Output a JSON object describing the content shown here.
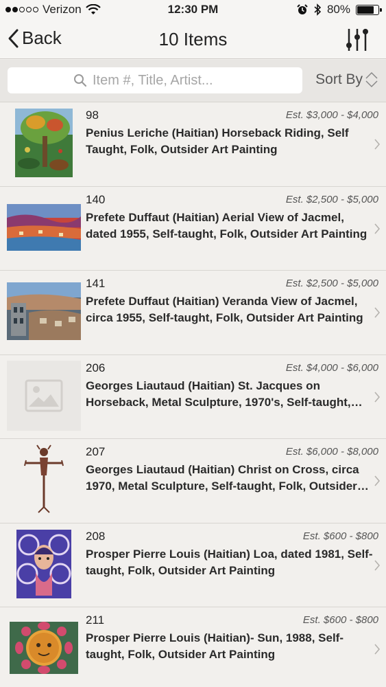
{
  "status_bar": {
    "carrier": "Verizon",
    "time": "12:30 PM",
    "battery": "80%",
    "battery_level": 0.8,
    "signal_bars_filled": 2,
    "signal_bars_total": 5
  },
  "nav": {
    "back_label": "Back",
    "title": "10 Items",
    "filter_icon": "sliders-icon"
  },
  "search": {
    "placeholder": "Item #, Title, Artist...",
    "sort_label": "Sort By"
  },
  "items": [
    {
      "lot": "98",
      "estimate": "Est. $3,000 - $4,000",
      "title": "Penius Leriche (Haitian)  Horseback Riding, Self Taught, Folk, Outsider Art Painting",
      "thumb": "painting-tree"
    },
    {
      "lot": "140",
      "estimate": "Est. $2,500 - $5,000",
      "title": "Prefete Duffaut (Haitian) Aerial View of Jacmel, dated 1955, Self-taught, Folk, Outsider Art Painting",
      "thumb": "painting-aerial"
    },
    {
      "lot": "141",
      "estimate": "Est. $2,500 - $5,000",
      "title": "Prefete Duffaut (Haitian) Veranda View of Jacmel, circa 1955, Self-taught, Folk, Outsider Art Painting",
      "thumb": "painting-veranda"
    },
    {
      "lot": "206",
      "estimate": "Est. $4,000 - $6,000",
      "title": "Georges Liautaud (Haitian) St. Jacques on Horseback, Metal Sculpture, 1970's, Self-taught, Folk, Outsider Art",
      "thumb": "placeholder"
    },
    {
      "lot": "207",
      "estimate": "Est. $6,000 - $8,000",
      "title": "Georges Liautaud (Haitian) Christ on Cross, circa 1970, Metal Sculpture, Self-taught, Folk, Outsider Art",
      "thumb": "sculpture-cross"
    },
    {
      "lot": "208",
      "estimate": "Est. $600 - $800",
      "title": "Prosper Pierre Louis (Haitian) Loa, dated 1981, Self-taught, Folk, Outsider Art Painting",
      "thumb": "painting-loa"
    },
    {
      "lot": "211",
      "estimate": "Est. $600 - $800",
      "title": "Prosper Pierre Louis (Haitian)- Sun, 1988, Self-taught, Folk, Outsider Art Painting",
      "thumb": "painting-sun"
    }
  ]
}
